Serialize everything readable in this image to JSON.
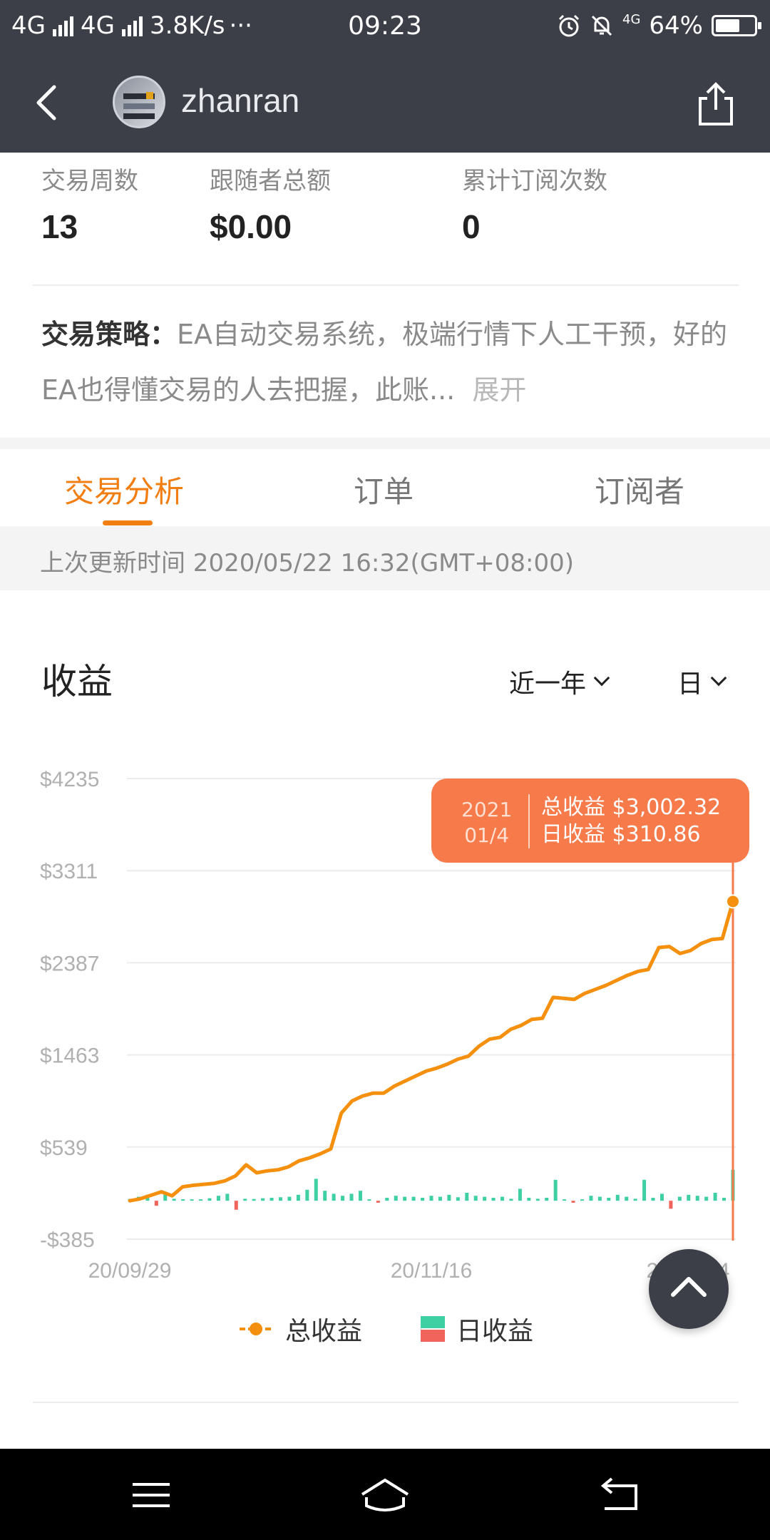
{
  "status_bar": {
    "network1": "4G",
    "network2": "4G",
    "speed": "3.8K/s",
    "more": "···",
    "time": "09:23",
    "battery_pct": "64%",
    "battery_level": 0.64,
    "net_small": "4G"
  },
  "header": {
    "username": "zhanran"
  },
  "stats": [
    {
      "label": "交易周数",
      "value": "13"
    },
    {
      "label": "跟随者总额",
      "value": "$0.00"
    },
    {
      "label": "累计订阅次数",
      "value": "0"
    }
  ],
  "strategy": {
    "heading": "交易策略：",
    "text": "EA自动交易系统，极端行情下人工干预，好的EA也得懂交易的人去把握，此账...",
    "expand": "展开"
  },
  "tabs": [
    {
      "label": "交易分析",
      "active": true
    },
    {
      "label": "订单",
      "active": false
    },
    {
      "label": "订阅者",
      "active": false
    }
  ],
  "update_text": "上次更新时间 2020/05/22 16:32(GMT+08:00)",
  "chart_section": {
    "title": "收益",
    "range_select": "近一年",
    "interval_select": "日"
  },
  "tooltip": {
    "year": "2021",
    "date": "01/4",
    "total_label": "总收益 $3,002.32",
    "daily_label": "日收益 $310.86"
  },
  "legend": {
    "total": "总收益",
    "daily": "日收益"
  },
  "colors": {
    "accent": "#f27d11",
    "line": "#f5900e",
    "positive_bar": "#3ecfa3",
    "negative_bar": "#f0645c",
    "tooltip_bg": "#f77a4a",
    "header_bg": "#3c3f47"
  },
  "chart_data": {
    "type": "line",
    "x_ticks": [
      "20/09/29",
      "20/11/16",
      "21/01/04"
    ],
    "y_ticks": [
      "$4235",
      "$3311",
      "$2387",
      "$1463",
      "$539",
      "-$385"
    ],
    "ylim": [
      -385,
      4235
    ],
    "grid": true,
    "series": [
      {
        "name": "总收益",
        "values": [
          0,
          20,
          55,
          90,
          50,
          140,
          155,
          165,
          175,
          200,
          250,
          360,
          280,
          300,
          310,
          340,
          400,
          430,
          470,
          520,
          880,
          1000,
          1050,
          1080,
          1080,
          1150,
          1200,
          1250,
          1300,
          1330,
          1370,
          1420,
          1450,
          1550,
          1620,
          1640,
          1720,
          1760,
          1820,
          1830,
          2040,
          2030,
          2020,
          2080,
          2120,
          2160,
          2210,
          2260,
          2300,
          2320,
          2540,
          2550,
          2480,
          2510,
          2580,
          2620,
          2630,
          3002.32
        ]
      },
      {
        "name": "日收益",
        "values": [
          18,
          40,
          60,
          -50,
          90,
          20,
          15,
          12,
          10,
          25,
          50,
          70,
          -90,
          20,
          18,
          25,
          30,
          35,
          40,
          60,
          110,
          220,
          100,
          70,
          50,
          70,
          100,
          8,
          -20,
          30,
          50,
          40,
          40,
          30,
          50,
          40,
          60,
          35,
          80,
          50,
          40,
          30,
          40,
          20,
          120,
          30,
          20,
          30,
          210,
          10,
          -20,
          10,
          50,
          40,
          30,
          60,
          40,
          20,
          210,
          30,
          70,
          -80,
          40,
          60,
          50,
          40,
          80,
          30,
          310.86
        ]
      }
    ],
    "highlight": {
      "x": "2021 01/4",
      "total": 3002.32,
      "daily": 310.86
    }
  }
}
